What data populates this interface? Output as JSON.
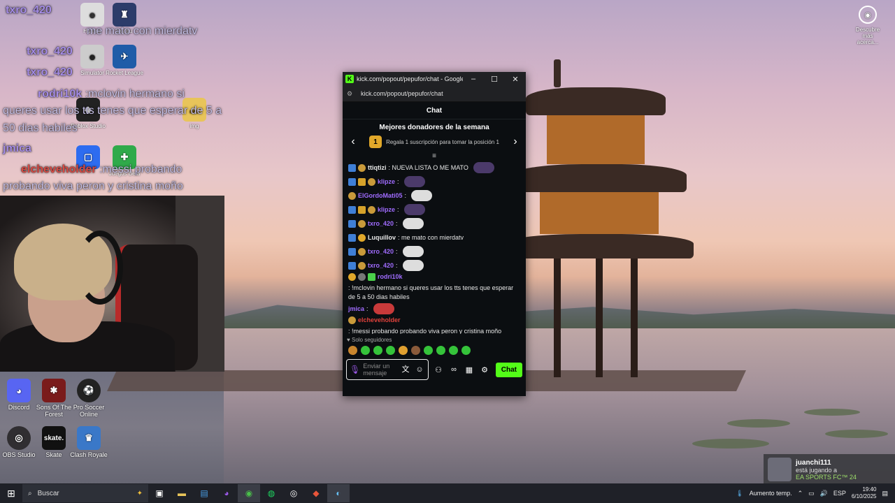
{
  "overlay": {
    "lines": [
      {
        "user": "txro_420",
        "text": ""
      },
      {
        "user": "",
        "text": "me mato con mierdatv"
      },
      {
        "user": "txro_420",
        "text": ""
      },
      {
        "user": "txro_420",
        "text": ""
      },
      {
        "user": "rodri10k",
        "text": ":mclovin hermano si"
      },
      {
        "user": "",
        "text": "queres usar los tts tenes que esperar de 5 a"
      },
      {
        "user": "",
        "text": "50 dias habiles"
      },
      {
        "user": "jmica",
        "text": ""
      },
      {
        "user": "elcheveholder",
        "text": ":messi probando"
      },
      {
        "user": "",
        "text": "probando viva peron y cristina moño"
      }
    ]
  },
  "desktop": {
    "icons_left": [
      {
        "label": "Discord",
        "icon": "discord-icon",
        "color": "#5865f2"
      },
      {
        "label": "Sons Of The Forest",
        "icon": "sons-of-the-forest-icon",
        "color": "#7a1b1b"
      },
      {
        "label": "Pro Soccer Online",
        "icon": "soccer-ball-icon",
        "color": "#222"
      },
      {
        "label": "OBS Studio",
        "icon": "obs-icon",
        "color": "#302e31"
      },
      {
        "label": "Skate",
        "icon": "skate-icon",
        "color": "#111"
      },
      {
        "label": "Clash Royale",
        "icon": "clash-royale-icon",
        "color": "#3a78c8"
      }
    ],
    "icons_top": [
      {
        "label": "Human",
        "icon": "human-icon",
        "color": "#ddd"
      },
      {
        "label": "Leagu",
        "icon": "tower-icon",
        "color": "#2c3c6a"
      },
      {
        "label": "Simulator",
        "icon": "game-icon",
        "color": "#ccc"
      },
      {
        "label": "Rocket League",
        "icon": "rocket-league-icon",
        "color": "#1f5ca8"
      },
      {
        "label": "Roblox Studio",
        "icon": "roblox-icon",
        "color": "#222"
      },
      {
        "label": "img",
        "icon": "folder-icon",
        "color": "#e8c45a"
      },
      {
        "label": "Juegos Beta",
        "icon": "xbox-icon",
        "color": "#2faa4a"
      }
    ],
    "top_right": {
      "label": "Descubre más acerca...",
      "icon": "camera-icon"
    }
  },
  "alert": {
    "user": "juanchi111",
    "status": "está jugando a",
    "game": "EA SPORTS FC™ 24"
  },
  "window": {
    "title": "kick.com/popout/pepufor/chat - Google...",
    "url": "kick.com/popout/pepufor/chat",
    "chat_header": "Chat",
    "donors_title": "Mejores donadores de la semana",
    "donors_rank": "1",
    "donors_text": "Regala 1 suscripción para tomar la posición 1",
    "messages": [
      {
        "user": "ttiqtizi",
        "color": "#e8e8e8",
        "text": ": NUEVA LISTA O ME MATO",
        "badges": [
          "sub",
          "coin"
        ],
        "emote": "dark"
      },
      {
        "user": "klipze",
        "color": "#a06cff",
        "text": ":",
        "badges": [
          "sub",
          "crown",
          "coin"
        ],
        "emote": "dark"
      },
      {
        "user": "ElGordoMati05",
        "color": "#a06cff",
        "text": ":",
        "badges": [
          "coin"
        ],
        "emote": "light"
      },
      {
        "user": "klipze",
        "color": "#a06cff",
        "text": ":",
        "badges": [
          "sub",
          "crown",
          "coin"
        ],
        "emote": "dark"
      },
      {
        "user": "txro_420",
        "color": "#a06cff",
        "text": ":",
        "badges": [
          "sub",
          "coin"
        ],
        "emote": "light"
      },
      {
        "user": "Luquillov",
        "color": "#e8e8e8",
        "text": ": me mato con mierdatv",
        "badges": [
          "sub",
          "one"
        ],
        "emote": ""
      },
      {
        "user": "txro_420",
        "color": "#a06cff",
        "text": ":",
        "badges": [
          "sub",
          "coin"
        ],
        "emote": "light"
      },
      {
        "user": "txro_420",
        "color": "#a06cff",
        "text": ":",
        "badges": [
          "sub",
          "coin"
        ],
        "emote": "light"
      },
      {
        "user": "rodri10k",
        "color": "#a06cff",
        "text": ": !mclovin hermano si queres usar los tts tenes que esperar de 5 a 50 dias habiles",
        "badges": [
          "one",
          "mod",
          "gift"
        ],
        "emote": ""
      },
      {
        "user": "jmica",
        "color": "#a06cff",
        "text": ":",
        "badges": [],
        "emote": "red"
      },
      {
        "user": "elcheveholder",
        "color": "#e0413b",
        "text": ": !messi probando probando viva peron y cristina moño",
        "badges": [
          "coin"
        ],
        "emote": ""
      }
    ],
    "followers_only": "Solo seguidores",
    "input_placeholder": "Enviar un mensaje",
    "send_label": "Chat"
  },
  "taskbar": {
    "search_placeholder": "Buscar",
    "weather": "Aumento temp.",
    "lang": "ESP",
    "time": "19:40",
    "date": "6/10/2025"
  }
}
